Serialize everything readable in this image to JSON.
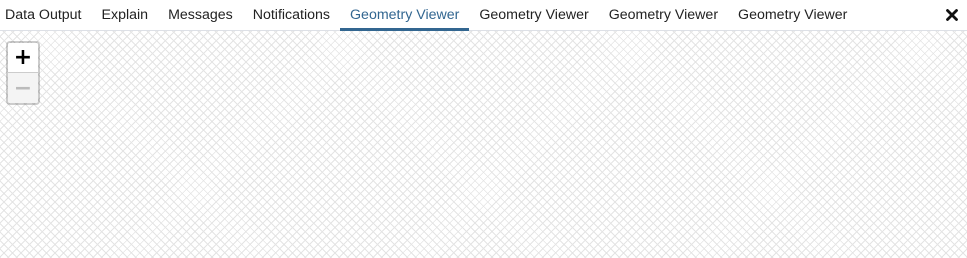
{
  "tabs": [
    {
      "label": "Data Output",
      "active": false
    },
    {
      "label": "Explain",
      "active": false
    },
    {
      "label": "Messages",
      "active": false
    },
    {
      "label": "Notifications",
      "active": false
    },
    {
      "label": "Geometry Viewer",
      "active": true
    },
    {
      "label": "Geometry Viewer",
      "active": false
    },
    {
      "label": "Geometry Viewer",
      "active": false
    },
    {
      "label": "Geometry Viewer",
      "active": false
    }
  ],
  "close_icon": "close-icon",
  "map": {
    "zoom_in_label": "+",
    "zoom_out_label": "−",
    "zoom_out_disabled": true
  },
  "colors": {
    "accent": "#326690",
    "tab_text": "#222222",
    "hatch": "#e4e4e4"
  }
}
